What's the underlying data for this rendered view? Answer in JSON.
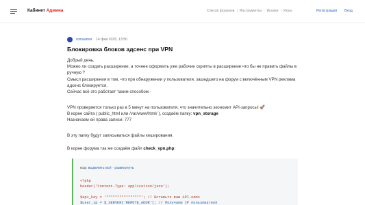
{
  "header": {
    "logo_prefix": "Кабинет",
    "logo_accent": "Админа",
    "nav": [
      "Список форумов",
      "Инструменты",
      "Иконки",
      "Игры"
    ],
    "register": "Регистрация",
    "login": "Вход"
  },
  "post": {
    "author": "romaamor",
    "date": "14 фев 2025, 13:50",
    "title": "Блокировка блоков адсенс при VPN",
    "paragraphs": [
      "Добрый день,",
      "Можно ли создать расширение, а точнее оформить уже рабочие скрипты в расширение что бы не править файлы в ручную ?",
      "Смысл расширения в том, что при обнаружении у пользователя, зашедшего на форум с включённым VPN реклама адсенс блокируется.",
      "Сейчас всё это работает таким способом -"
    ],
    "vpn_line": "VPN проверяется только раз в 5 минут на пользователя, что значительно экономит API-запросы!",
    "rocket": "🚀",
    "root_line_prefix": "В корне сайта ( public_html или /var/www/html/ ), создаём папку:",
    "root_folder": "vpn_storage",
    "rights_line": "Назначаем ей права записи: 777",
    "cache_line": "В эту папку будут записываться файлы кеширования.",
    "file_line_prefix": "В корне форума так же создаём файл",
    "file_name": "check_vpn.php",
    "file_line_suffix": ":"
  },
  "code": {
    "label": "код:",
    "select_all": "выделить всё",
    "separator": "·",
    "expand": "развернуть",
    "lines": [
      "<?php",
      "header('Content-Type: application/json');",
      "$api_key = '****************'; // Вставьте ваш API-ключ",
      "$user_ip = $_SERVER['REMOTE_ADDR']; // Получаем IP пользователя"
    ]
  }
}
